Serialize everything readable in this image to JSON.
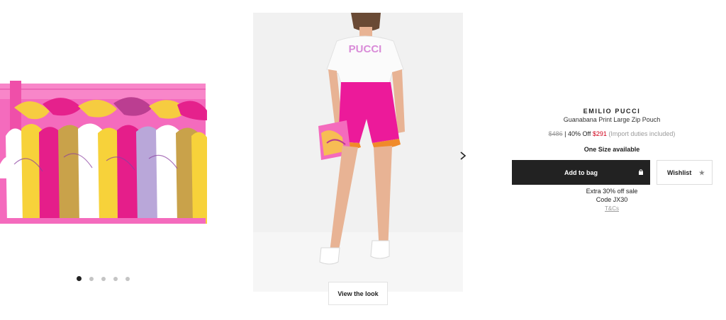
{
  "gallery": {
    "view_look_label": "View the look",
    "dot_count": 5,
    "active_dot": 0,
    "next_icon": "chevron-right-icon"
  },
  "product": {
    "brand": "EMILIO PUCCI",
    "name": "Guanabana Print Large Zip Pouch",
    "model_shirt_text": "PUCCI",
    "price": {
      "original": "$486",
      "separator": "|",
      "discount": "40% Off",
      "sale": "$291",
      "duty_note": "(Import duties included)"
    },
    "size_note": "One Size available"
  },
  "actions": {
    "add_to_bag_label": "Add to bag",
    "add_to_bag_icon": "lock-icon",
    "wishlist_label": "Wishlist",
    "wishlist_icon": "star-icon"
  },
  "promo": {
    "line1": "Extra 30% off sale",
    "line2": "Code JX30",
    "terms_label": "T&Cs"
  },
  "colors": {
    "accent_dark": "#222222",
    "sale_red": "#d0021b",
    "pouch_pink": "#f25fb4",
    "shorts_pink": "#ec1a9a"
  }
}
